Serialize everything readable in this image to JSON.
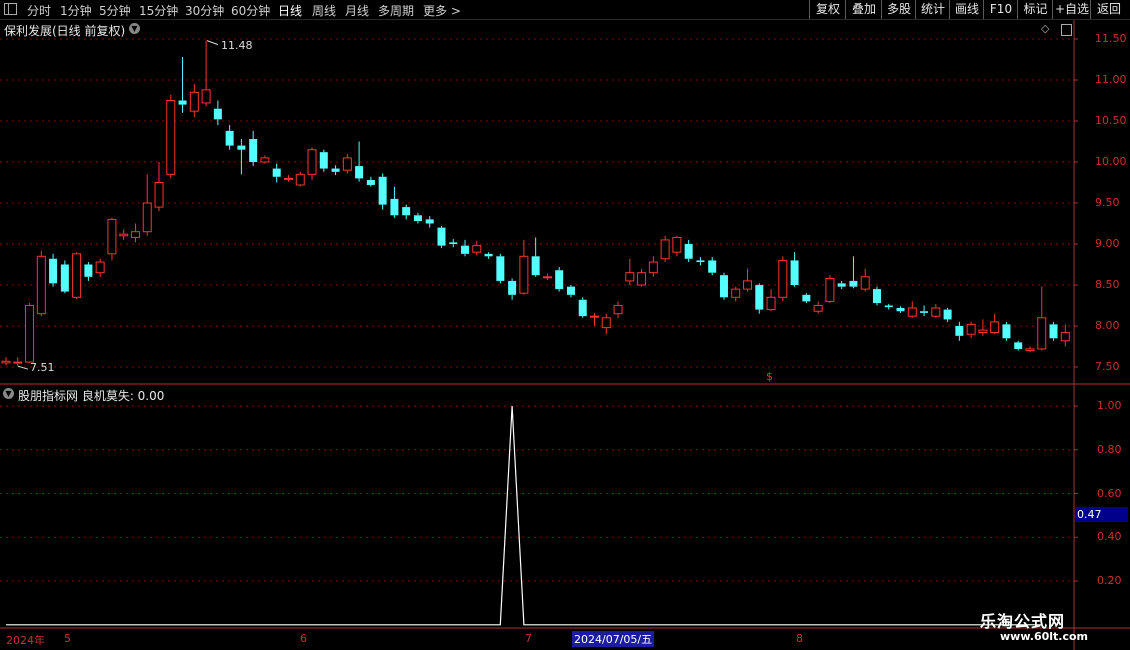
{
  "toolbar": {
    "periods": [
      "分时",
      "1分钟",
      "5分钟",
      "15分钟",
      "30分钟",
      "60分钟",
      "日线",
      "周线",
      "月线",
      "多周期",
      "更多"
    ],
    "active_period": "日线",
    "buttons": [
      "复权",
      "叠加",
      "多股",
      "统计",
      "画线",
      "F10",
      "标记",
      "+自选",
      "返回"
    ]
  },
  "main_chart": {
    "title": "保利发展(日线 前复权)",
    "high_label": "11.48",
    "low_label": "7.51",
    "y_ticks": [
      "11.50",
      "11.00",
      "10.50",
      "10.00",
      "9.50",
      "9.00",
      "8.50",
      "8.00",
      "7.50"
    ],
    "marker": "$"
  },
  "indicator": {
    "title": "股朋指标网  良机莫失: 0.00",
    "y_ticks": [
      "1.00",
      "0.80",
      "0.60",
      "0.40",
      "0.20"
    ],
    "current_value": "0.47"
  },
  "date_axis": {
    "year_label": "2024年",
    "month_labels": [
      "5",
      "6",
      "7",
      "8"
    ],
    "cursor_date": "2024/07/05/五"
  },
  "watermark": {
    "line1": "乐淘公式网",
    "line2": "www.60lt.com"
  },
  "colors": {
    "up": "#ff3232",
    "down": "#54ffff",
    "grid": "#8b0000",
    "axis": "#b03030"
  },
  "chart_data": [
    {
      "type": "candlestick",
      "title": "保利发展(日线 前复权)",
      "y_range": [
        7.3,
        11.7
      ],
      "candles": [
        {
          "o": 7.55,
          "c": 7.57,
          "h": 7.62,
          "l": 7.52
        },
        {
          "o": 7.55,
          "c": 7.56,
          "h": 7.62,
          "l": 7.51
        },
        {
          "o": 7.56,
          "c": 8.25,
          "h": 8.28,
          "l": 7.55
        },
        {
          "o": 8.15,
          "c": 8.85,
          "h": 8.92,
          "l": 8.12
        },
        {
          "o": 8.82,
          "c": 8.52,
          "h": 8.88,
          "l": 8.48
        },
        {
          "o": 8.75,
          "c": 8.42,
          "h": 8.8,
          "l": 8.4
        },
        {
          "o": 8.35,
          "c": 8.88,
          "h": 8.9,
          "l": 8.33
        },
        {
          "o": 8.75,
          "c": 8.6,
          "h": 8.78,
          "l": 8.55
        },
        {
          "o": 8.65,
          "c": 8.78,
          "h": 8.82,
          "l": 8.6
        },
        {
          "o": 8.88,
          "c": 9.3,
          "h": 9.32,
          "l": 8.8
        },
        {
          "o": 9.1,
          "c": 9.12,
          "h": 9.18,
          "l": 9.05
        },
        {
          "o": 9.08,
          "c": 9.15,
          "h": 9.25,
          "l": 9.02
        },
        {
          "o": 9.15,
          "c": 9.5,
          "h": 9.85,
          "l": 9.1
        },
        {
          "o": 9.45,
          "c": 9.75,
          "h": 10.0,
          "l": 9.4
        },
        {
          "o": 9.85,
          "c": 10.75,
          "h": 10.82,
          "l": 9.8
        },
        {
          "o": 10.75,
          "c": 10.7,
          "h": 11.28,
          "l": 10.6
        },
        {
          "o": 10.62,
          "c": 10.85,
          "h": 10.95,
          "l": 10.55
        },
        {
          "o": 10.72,
          "c": 10.88,
          "h": 11.48,
          "l": 10.68
        },
        {
          "o": 10.65,
          "c": 10.52,
          "h": 10.75,
          "l": 10.45
        },
        {
          "o": 10.38,
          "c": 10.2,
          "h": 10.45,
          "l": 10.15
        },
        {
          "o": 10.2,
          "c": 10.15,
          "h": 10.28,
          "l": 9.85
        },
        {
          "o": 10.28,
          "c": 10.0,
          "h": 10.38,
          "l": 9.95
        },
        {
          "o": 10.0,
          "c": 10.05,
          "h": 10.08,
          "l": 9.98
        },
        {
          "o": 9.92,
          "c": 9.82,
          "h": 9.98,
          "l": 9.75
        },
        {
          "o": 9.8,
          "c": 9.8,
          "h": 9.84,
          "l": 9.76
        },
        {
          "o": 9.72,
          "c": 9.85,
          "h": 9.88,
          "l": 9.7
        },
        {
          "o": 9.85,
          "c": 10.15,
          "h": 10.18,
          "l": 9.78
        },
        {
          "o": 10.12,
          "c": 9.92,
          "h": 10.15,
          "l": 9.88
        },
        {
          "o": 9.92,
          "c": 9.88,
          "h": 9.96,
          "l": 9.84
        },
        {
          "o": 9.9,
          "c": 10.05,
          "h": 10.1,
          "l": 9.86
        },
        {
          "o": 9.95,
          "c": 9.8,
          "h": 10.25,
          "l": 9.76
        },
        {
          "o": 9.78,
          "c": 9.72,
          "h": 9.82,
          "l": 9.7
        },
        {
          "o": 9.82,
          "c": 9.48,
          "h": 9.86,
          "l": 9.42
        },
        {
          "o": 9.55,
          "c": 9.35,
          "h": 9.7,
          "l": 9.32
        },
        {
          "o": 9.45,
          "c": 9.35,
          "h": 9.48,
          "l": 9.3
        },
        {
          "o": 9.35,
          "c": 9.28,
          "h": 9.38,
          "l": 9.25
        },
        {
          "o": 9.3,
          "c": 9.25,
          "h": 9.34,
          "l": 9.2
        },
        {
          "o": 9.2,
          "c": 8.98,
          "h": 9.22,
          "l": 8.95
        },
        {
          "o": 9.02,
          "c": 9.0,
          "h": 9.06,
          "l": 8.96
        },
        {
          "o": 8.98,
          "c": 8.88,
          "h": 9.05,
          "l": 8.85
        },
        {
          "o": 8.9,
          "c": 8.98,
          "h": 9.04,
          "l": 8.86
        },
        {
          "o": 8.88,
          "c": 8.85,
          "h": 8.9,
          "l": 8.82
        },
        {
          "o": 8.85,
          "c": 8.55,
          "h": 8.88,
          "l": 8.52
        },
        {
          "o": 8.55,
          "c": 8.38,
          "h": 8.58,
          "l": 8.32
        },
        {
          "o": 8.4,
          "c": 8.85,
          "h": 9.05,
          "l": 8.38
        },
        {
          "o": 8.85,
          "c": 8.62,
          "h": 9.08,
          "l": 8.6
        },
        {
          "o": 8.6,
          "c": 8.6,
          "h": 8.64,
          "l": 8.56
        },
        {
          "o": 8.68,
          "c": 8.45,
          "h": 8.72,
          "l": 8.42
        },
        {
          "o": 8.48,
          "c": 8.38,
          "h": 8.5,
          "l": 8.35
        },
        {
          "o": 8.32,
          "c": 8.12,
          "h": 8.35,
          "l": 8.1
        },
        {
          "o": 8.12,
          "c": 8.12,
          "h": 8.16,
          "l": 8.0
        },
        {
          "o": 7.98,
          "c": 8.1,
          "h": 8.15,
          "l": 7.9
        },
        {
          "o": 8.15,
          "c": 8.25,
          "h": 8.3,
          "l": 8.1
        },
        {
          "o": 8.55,
          "c": 8.65,
          "h": 8.82,
          "l": 8.5
        },
        {
          "o": 8.5,
          "c": 8.65,
          "h": 8.7,
          "l": 8.48
        },
        {
          "o": 8.65,
          "c": 8.78,
          "h": 8.85,
          "l": 8.6
        },
        {
          "o": 8.82,
          "c": 9.05,
          "h": 9.1,
          "l": 8.78
        },
        {
          "o": 8.9,
          "c": 9.08,
          "h": 9.1,
          "l": 8.85
        },
        {
          "o": 9.0,
          "c": 8.82,
          "h": 9.05,
          "l": 8.78
        },
        {
          "o": 8.8,
          "c": 8.78,
          "h": 8.84,
          "l": 8.74
        },
        {
          "o": 8.8,
          "c": 8.65,
          "h": 8.84,
          "l": 8.62
        },
        {
          "o": 8.62,
          "c": 8.35,
          "h": 8.65,
          "l": 8.32
        },
        {
          "o": 8.35,
          "c": 8.45,
          "h": 8.48,
          "l": 8.3
        },
        {
          "o": 8.45,
          "c": 8.55,
          "h": 8.7,
          "l": 8.42
        },
        {
          "o": 8.5,
          "c": 8.2,
          "h": 8.52,
          "l": 8.15
        },
        {
          "o": 8.2,
          "c": 8.35,
          "h": 8.45,
          "l": 8.18
        },
        {
          "o": 8.35,
          "c": 8.8,
          "h": 8.85,
          "l": 8.3
        },
        {
          "o": 8.8,
          "c": 8.5,
          "h": 8.9,
          "l": 8.48
        },
        {
          "o": 8.38,
          "c": 8.3,
          "h": 8.4,
          "l": 8.28
        },
        {
          "o": 8.18,
          "c": 8.25,
          "h": 8.3,
          "l": 8.15
        },
        {
          "o": 8.3,
          "c": 8.58,
          "h": 8.62,
          "l": 8.28
        },
        {
          "o": 8.52,
          "c": 8.48,
          "h": 8.55,
          "l": 8.45
        },
        {
          "o": 8.55,
          "c": 8.48,
          "h": 8.85,
          "l": 8.46
        },
        {
          "o": 8.45,
          "c": 8.6,
          "h": 8.7,
          "l": 8.42
        },
        {
          "o": 8.45,
          "c": 8.28,
          "h": 8.48,
          "l": 8.25
        },
        {
          "o": 8.25,
          "c": 8.23,
          "h": 8.27,
          "l": 8.2
        },
        {
          "o": 8.22,
          "c": 8.18,
          "h": 8.24,
          "l": 8.16
        },
        {
          "o": 8.12,
          "c": 8.22,
          "h": 8.3,
          "l": 8.1
        },
        {
          "o": 8.18,
          "c": 8.16,
          "h": 8.25,
          "l": 8.12
        },
        {
          "o": 8.12,
          "c": 8.22,
          "h": 8.27,
          "l": 8.1
        },
        {
          "o": 8.2,
          "c": 8.08,
          "h": 8.22,
          "l": 8.05
        },
        {
          "o": 8.0,
          "c": 7.88,
          "h": 8.05,
          "l": 7.82
        },
        {
          "o": 7.9,
          "c": 8.02,
          "h": 8.05,
          "l": 7.85
        },
        {
          "o": 7.92,
          "c": 7.95,
          "h": 8.08,
          "l": 7.88
        },
        {
          "o": 7.92,
          "c": 8.05,
          "h": 8.15,
          "l": 7.9
        },
        {
          "o": 8.02,
          "c": 7.85,
          "h": 8.05,
          "l": 7.82
        },
        {
          "o": 7.8,
          "c": 7.72,
          "h": 7.82,
          "l": 7.7
        },
        {
          "o": 7.7,
          "c": 7.72,
          "h": 7.75,
          "l": 7.68
        },
        {
          "o": 7.72,
          "c": 8.1,
          "h": 8.48,
          "l": 7.7
        },
        {
          "o": 8.02,
          "c": 7.85,
          "h": 8.05,
          "l": 7.82
        },
        {
          "o": 7.82,
          "c": 7.92,
          "h": 8.02,
          "l": 7.75
        }
      ]
    },
    {
      "type": "line",
      "title": "良机莫失",
      "y_range": [
        0.1,
        1.1
      ],
      "series": [
        {
          "values": [
            0,
            0,
            0,
            0,
            0,
            0,
            0,
            0,
            0,
            0,
            0,
            0,
            0,
            0,
            0,
            0,
            0,
            0,
            0,
            0,
            0,
            0,
            0,
            0,
            0,
            0,
            0,
            0,
            0,
            0,
            0,
            0,
            0,
            0,
            0,
            0,
            0,
            0,
            0,
            0,
            0,
            0,
            0,
            1,
            0,
            0,
            0,
            0,
            0,
            0,
            0,
            0,
            0,
            0,
            0,
            0,
            0,
            0,
            0,
            0,
            0,
            0,
            0,
            0,
            0,
            0,
            0,
            0,
            0,
            0,
            0,
            0,
            0,
            0,
            0,
            0,
            0,
            0,
            0,
            0,
            0,
            0,
            0,
            0,
            0,
            0,
            0,
            0,
            0
          ]
        }
      ]
    }
  ]
}
